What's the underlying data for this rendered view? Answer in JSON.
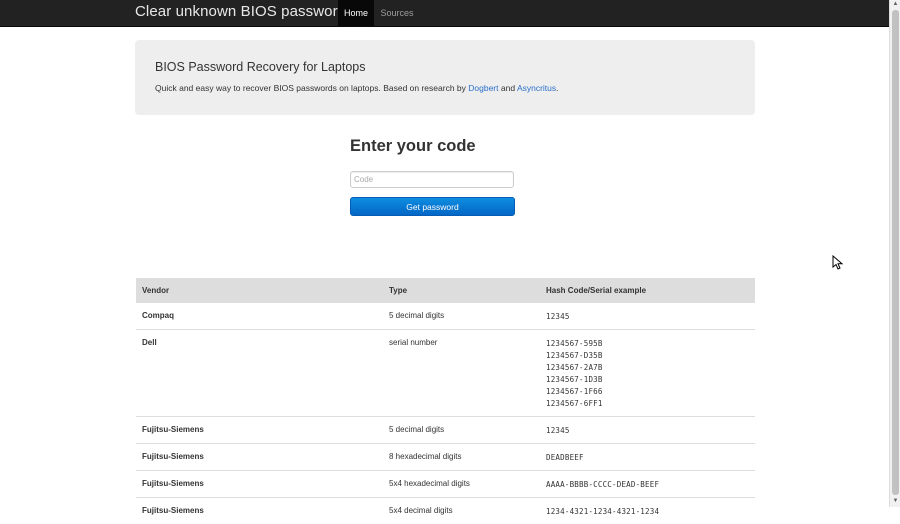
{
  "navbar": {
    "brand": "Clear unknown BIOS passwords",
    "items": [
      {
        "label": "Home",
        "active": true
      },
      {
        "label": "Sources",
        "active": false
      }
    ]
  },
  "jumbotron": {
    "title": "BIOS Password Recovery for Laptops",
    "desc_prefix": "Quick and easy way to recover BIOS passwords on laptops. Based on research by ",
    "link1": "Dogbert",
    "desc_mid": " and ",
    "link2": "Asyncritus",
    "desc_suffix": "."
  },
  "form": {
    "heading": "Enter your code",
    "input_placeholder": "Code",
    "input_value": "",
    "button_label": "Get password"
  },
  "table": {
    "headers": [
      "Vendor",
      "Type",
      "Hash Code/Serial example"
    ],
    "rows": [
      {
        "vendor": "Compaq",
        "type": "5 decimal digits",
        "examples": [
          "12345"
        ]
      },
      {
        "vendor": "Dell",
        "type": "serial number",
        "examples": [
          "1234567-595B",
          "1234567-D35B",
          "1234567-2A7B",
          "1234567-1D3B",
          "1234567-1F66",
          "1234567-6FF1"
        ]
      },
      {
        "vendor": "Fujitsu-Siemens",
        "type": "5 decimal digits",
        "examples": [
          "12345"
        ]
      },
      {
        "vendor": "Fujitsu-Siemens",
        "type": "8 hexadecimal digits",
        "examples": [
          "DEADBEEF"
        ]
      },
      {
        "vendor": "Fujitsu-Siemens",
        "type": "5x4 hexadecimal digits",
        "examples": [
          "AAAA-BBBB-CCCC-DEAD-BEEF"
        ]
      },
      {
        "vendor": "Fujitsu-Siemens",
        "type": "5x4 decimal digits",
        "examples": [
          "1234-4321-1234-4321-1234"
        ]
      }
    ]
  },
  "colors": {
    "navbar_bg": "#222222",
    "accent": "#0466c6",
    "link": "#2a6fc9"
  }
}
